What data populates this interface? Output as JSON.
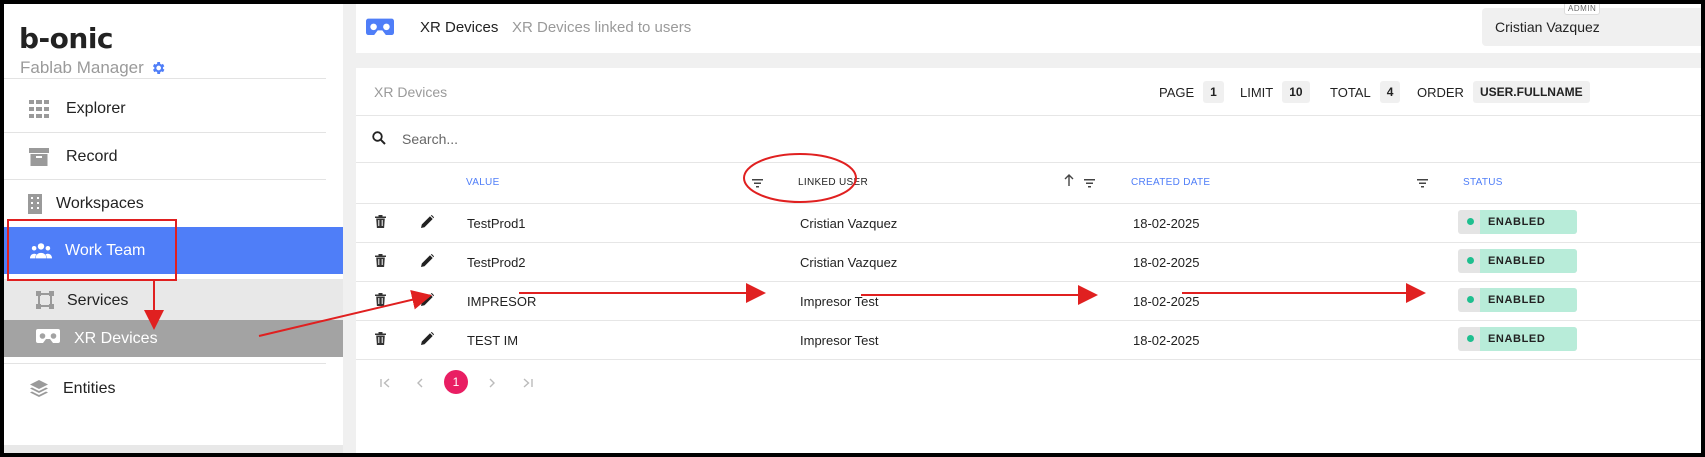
{
  "brand": {
    "logo": "b-onic",
    "subtitle": "Fablab Manager"
  },
  "sidebar": {
    "items": [
      {
        "label": "Explorer",
        "icon": "grid-icon"
      },
      {
        "label": "Record",
        "icon": "archive-icon"
      },
      {
        "label": "Workspaces",
        "icon": "building-icon"
      },
      {
        "label": "Work Team",
        "icon": "people-icon",
        "active": true
      },
      {
        "label": "Services",
        "icon": "frame-icon"
      },
      {
        "label": "XR Devices",
        "icon": "vr-headset-icon",
        "active": true
      },
      {
        "label": "Entities",
        "icon": "layers-icon"
      }
    ]
  },
  "header": {
    "title": "XR Devices",
    "breadcrumb": "XR Devices linked to users",
    "user_name": "Cristian Vazquez",
    "user_role": "ADMIN"
  },
  "card": {
    "title": "XR Devices",
    "page_label": "PAGE",
    "page_value": "1",
    "limit_label": "LIMIT",
    "limit_value": "10",
    "total_label": "TOTAL",
    "total_value": "4",
    "order_label": "ORDER",
    "order_value": "USER.FULLNAME"
  },
  "search": {
    "placeholder": "Search..."
  },
  "table": {
    "columns": [
      "VALUE",
      "LINKED USER",
      "CREATED DATE",
      "STATUS"
    ],
    "rows": [
      {
        "value": "TestProd1",
        "linked_user": "Cristian Vazquez",
        "created": "18-02-2025",
        "status": "ENABLED"
      },
      {
        "value": "TestProd2",
        "linked_user": "Cristian Vazquez",
        "created": "18-02-2025",
        "status": "ENABLED"
      },
      {
        "value": "IMPRESOR",
        "linked_user": "Impresor Test",
        "created": "18-02-2025",
        "status": "ENABLED"
      },
      {
        "value": "TEST IM",
        "linked_user": "Impresor Test",
        "created": "18-02-2025",
        "status": "ENABLED"
      }
    ]
  },
  "pagination": {
    "current": "1"
  },
  "colors": {
    "accent": "#4f7ef8",
    "annotation": "#e02020",
    "status_green": "#1fbf8f",
    "page_pink": "#e91e63"
  }
}
